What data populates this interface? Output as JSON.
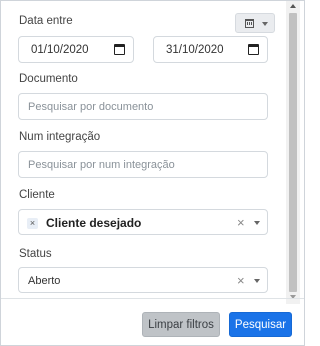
{
  "filters": {
    "date": {
      "label": "Data entre",
      "start_value": "01/10/2020",
      "end_value": "31/10/2020"
    },
    "document": {
      "label": "Documento",
      "placeholder": "Pesquisar por documento"
    },
    "integration": {
      "label": "Num integração",
      "placeholder": "Pesquisar por num integração"
    },
    "client": {
      "label": "Cliente",
      "selected": "Cliente desejado",
      "remove_glyph": "×",
      "clear_glyph": "×"
    },
    "status": {
      "label": "Status",
      "selected": "Aberto",
      "clear_glyph": "×"
    }
  },
  "footer": {
    "clear_label": "Limpar filtros",
    "search_label": "Pesquisar"
  },
  "icons": {
    "date_range_button": "calendar-icon",
    "date_picker": "calendar-icon"
  },
  "colors": {
    "primary": "#1a73e8",
    "secondary": "#bfc3c7"
  }
}
